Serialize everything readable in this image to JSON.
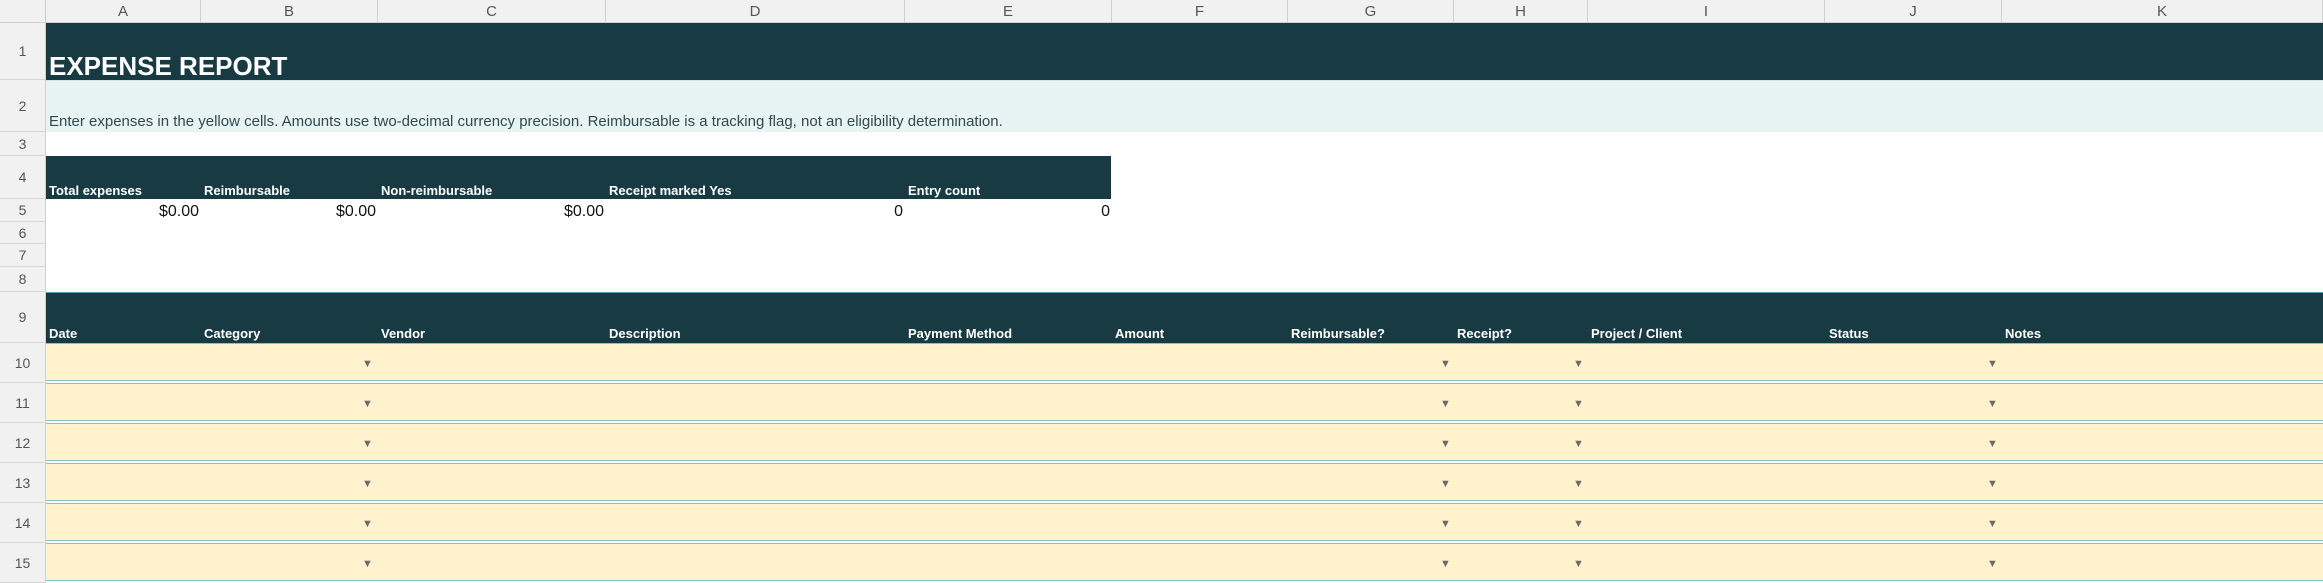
{
  "columns": [
    "A",
    "B",
    "C",
    "D",
    "E",
    "F",
    "G",
    "H",
    "I",
    "J",
    "K"
  ],
  "rows": [
    "1",
    "2",
    "3",
    "4",
    "5",
    "6",
    "7",
    "8",
    "9",
    "10",
    "11",
    "12",
    "13",
    "14",
    "15"
  ],
  "title": "EXPENSE REPORT",
  "instructions": "Enter expenses in the yellow cells. Amounts use two-decimal currency precision. Reimbursable is a tracking flag, not an eligibility determination.",
  "summary": {
    "labels": [
      "Total expenses",
      "Reimbursable",
      "Non-reimbursable",
      "Receipt marked Yes",
      "Entry count"
    ],
    "values": [
      "$0.00",
      "$0.00",
      "$0.00",
      "0",
      "0"
    ]
  },
  "table": {
    "headers": [
      "Date",
      "Category",
      "Vendor",
      "Description",
      "Payment Method",
      "Amount",
      "Reimbursable?",
      "Receipt?",
      "Project / Client",
      "Status",
      "Notes"
    ]
  },
  "icons": {
    "dropdown": "▼"
  },
  "colors": {
    "header_bg": "#183a42",
    "note_bg": "#e8f3f3",
    "input_bg": "#fff2cc"
  }
}
